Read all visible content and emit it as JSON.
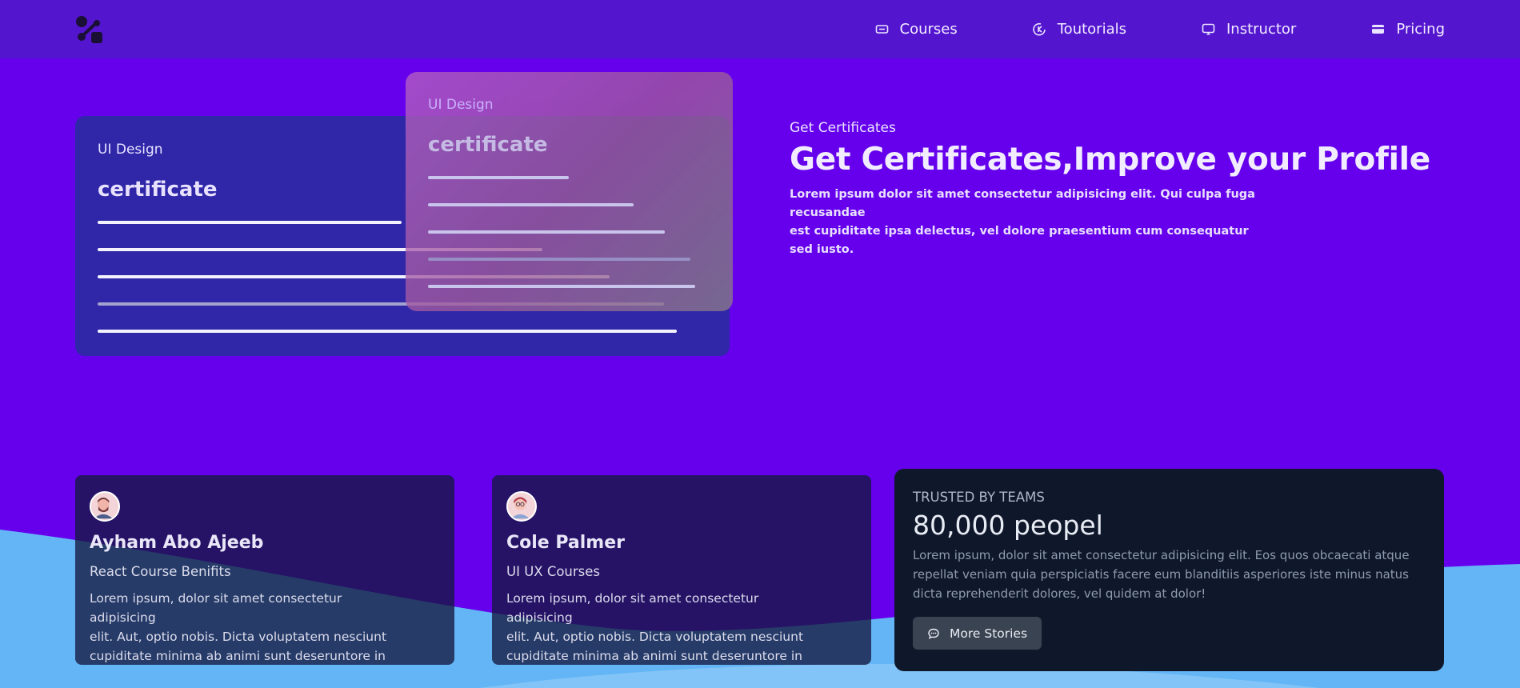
{
  "nav": {
    "items": [
      {
        "label": "Courses",
        "icon": "keyboard-icon"
      },
      {
        "label": "Toutorials",
        "icon": "tutorial-icon"
      },
      {
        "label": "Instructor",
        "icon": "screen-icon"
      },
      {
        "label": "Pricing",
        "icon": "credit-card-icon"
      }
    ]
  },
  "certificate": {
    "back": {
      "kicker": "UI Design",
      "title": "certificate"
    },
    "front": {
      "kicker": "UI Design",
      "title": "certificate"
    }
  },
  "hero": {
    "kicker": "Get Certificates",
    "title": "Get Certificates,Improve your Profile",
    "desc_1": "Lorem ipsum dolor sit amet consectetur adipisicing elit. Qui culpa fuga recusandae",
    "desc_2": "est cupiditate ipsa delectus, vel dolore praesentium cum consequatur sed iusto."
  },
  "testimonials": [
    {
      "name": "Ayham Abo Ajeeb",
      "course": "React Course Benifits",
      "body_1": "Lorem ipsum, dolor sit amet consectetur adipisicing",
      "body_2": "elit. Aut, optio nobis. Dicta voluptatem nesciunt",
      "body_3": "cupiditate minima ab animi sunt deseruntore in"
    },
    {
      "name": "Cole Palmer",
      "course": "UI UX Courses",
      "body_1": "Lorem ipsum, dolor sit amet consectetur adipisicing",
      "body_2": "elit. Aut, optio nobis. Dicta voluptatem nesciunt",
      "body_3": "cupiditate minima ab animi sunt deseruntore in"
    }
  ],
  "trust": {
    "kicker": "Trusted by teams",
    "number": "80,000 peopel",
    "desc": "Lorem ipsum, dolor sit amet consectetur adipisicing elit. Eos quos obcaecati atque repellat veniam quia perspiciatis facere eum blanditiis asperiores iste minus natus dicta reprehenderit dolores, vel quidem at dolor!",
    "button": "More Stories"
  },
  "colors": {
    "hero_bg": "#6600ec",
    "navbar_bg": "#5415cf",
    "wave": "#64b5f5",
    "card_dark": "#0f172a"
  }
}
